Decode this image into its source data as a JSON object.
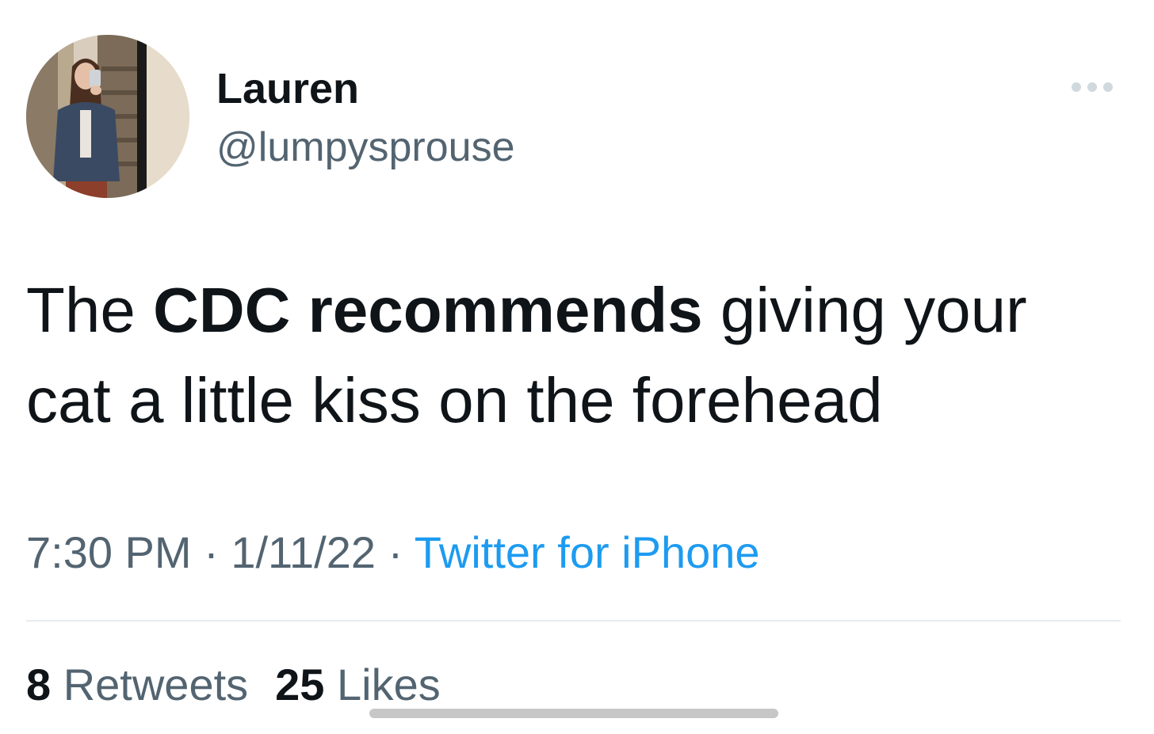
{
  "author": {
    "display_name": "Lauren",
    "handle": "@lumpysprouse"
  },
  "tweet": {
    "text_part1": "The ",
    "text_bold": "CDC recommends",
    "text_part2": " giving your cat a little kiss on the forehead"
  },
  "meta": {
    "time": "7:30 PM",
    "separator": "·",
    "date": "1/11/22",
    "source": "Twitter for iPhone"
  },
  "stats": {
    "retweets_count": "8",
    "retweets_label": "Retweets",
    "likes_count": "25",
    "likes_label": "Likes"
  },
  "icons": {
    "more": "more-horizontal-icon",
    "avatar": "profile-photo"
  },
  "colors": {
    "text": "#0f1419",
    "secondary": "#536471",
    "link": "#1d9bf0",
    "divider": "#e6ecf0"
  }
}
